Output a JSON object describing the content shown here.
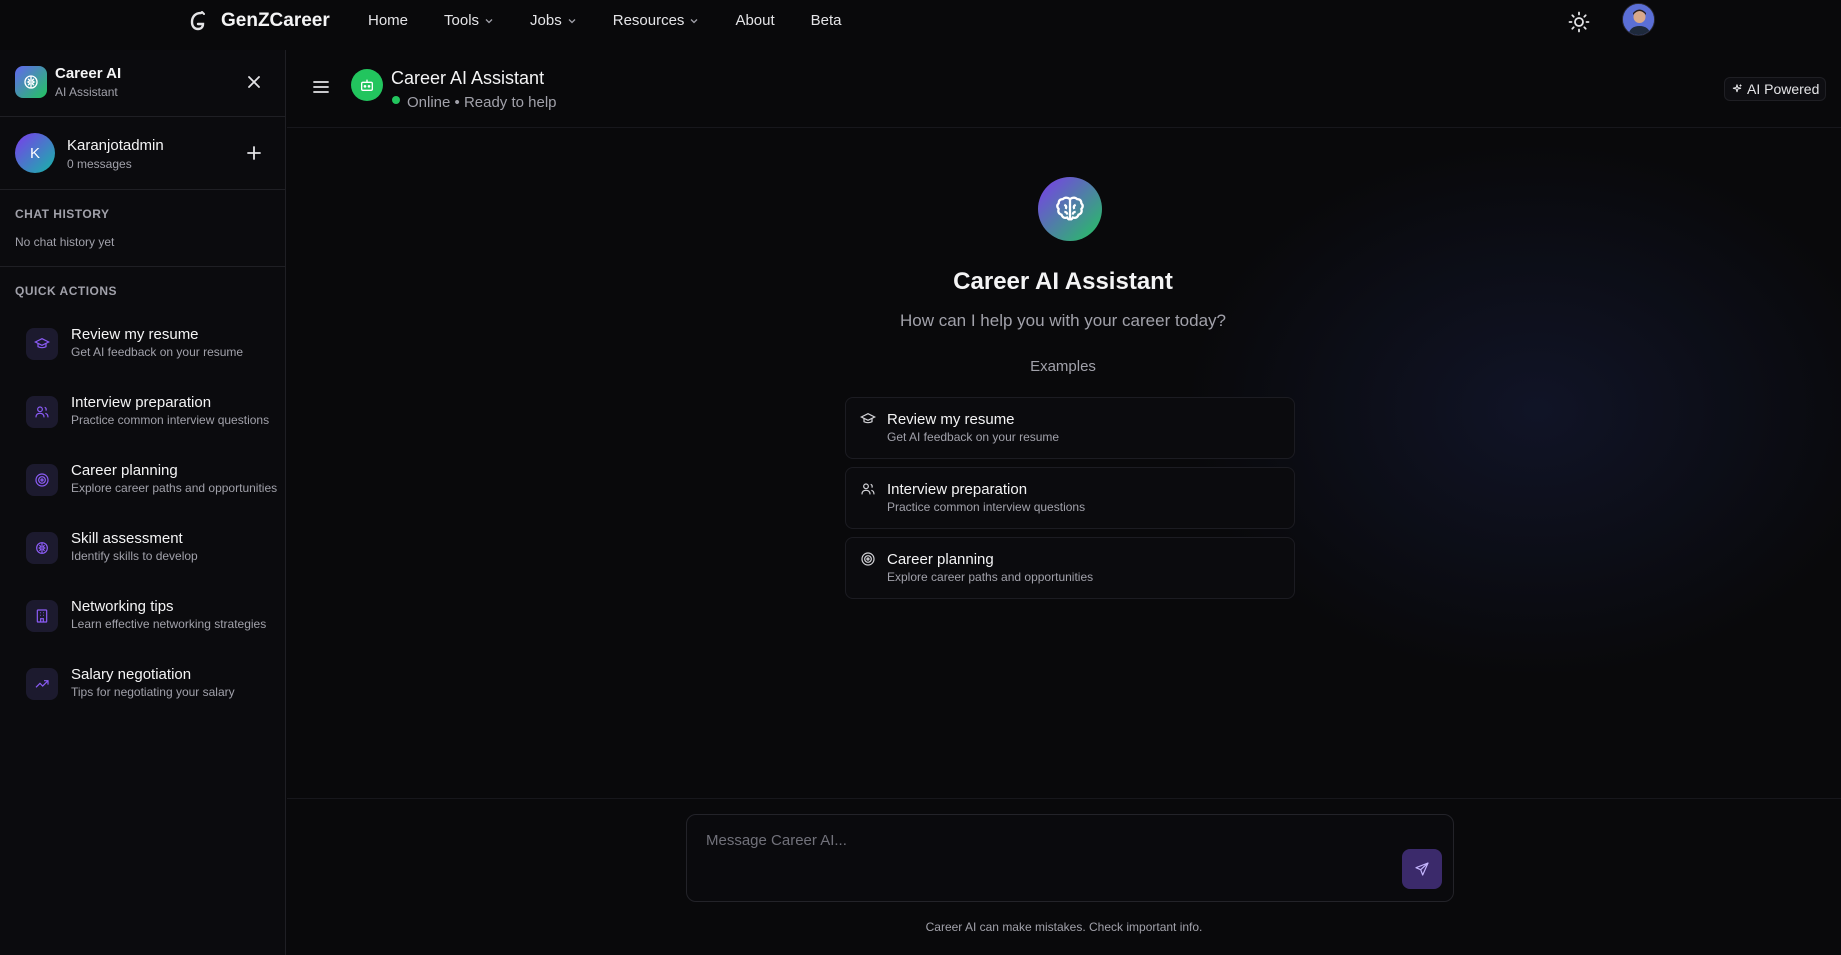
{
  "nav": {
    "brand": "GenZCareer",
    "links": [
      {
        "label": "Home"
      },
      {
        "label": "Tools"
      },
      {
        "label": "Jobs"
      },
      {
        "label": "Resources"
      },
      {
        "label": "About"
      },
      {
        "label": "Beta"
      }
    ]
  },
  "sidebar": {
    "title": "Career AI",
    "subtitle": "AI Assistant",
    "user": {
      "initial": "K",
      "name": "Karanjotadmin",
      "message_count": "0 messages"
    },
    "history_title": "CHAT HISTORY",
    "history_empty": "No chat history yet",
    "quick_actions_title": "QUICK ACTIONS",
    "quick_actions": [
      {
        "title": "Review my resume",
        "desc": "Get AI feedback on your resume",
        "icon": "graduation-cap-icon"
      },
      {
        "title": "Interview preparation",
        "desc": "Practice common interview questions",
        "icon": "users-icon"
      },
      {
        "title": "Career planning",
        "desc": "Explore career paths and opportunities",
        "icon": "target-icon"
      },
      {
        "title": "Skill assessment",
        "desc": "Identify skills to develop",
        "icon": "brain-icon"
      },
      {
        "title": "Networking tips",
        "desc": "Learn effective networking strategies",
        "icon": "building-icon"
      },
      {
        "title": "Salary negotiation",
        "desc": "Tips for negotiating your salary",
        "icon": "trending-up-icon"
      }
    ]
  },
  "header": {
    "title": "Career AI Assistant",
    "status": "Online • Ready to help",
    "badge": "AI Powered"
  },
  "hero": {
    "title": "Career AI Assistant",
    "subtitle": "How can I help you with your career today?",
    "examples_label": "Examples",
    "examples": [
      {
        "title": "Review my resume",
        "desc": "Get AI feedback on your resume",
        "icon": "graduation-cap-icon"
      },
      {
        "title": "Interview preparation",
        "desc": "Practice common interview questions",
        "icon": "users-icon"
      },
      {
        "title": "Career planning",
        "desc": "Explore career paths and opportunities",
        "icon": "target-icon"
      }
    ]
  },
  "composer": {
    "placeholder": "Message Career AI...",
    "value": "",
    "disclaimer": "Career AI can make mistakes. Check important info."
  },
  "colors": {
    "background": "#09090b",
    "accent_purple": "#7c3aed",
    "online_green": "#22c55e",
    "send_button": "#3b2a6b"
  }
}
